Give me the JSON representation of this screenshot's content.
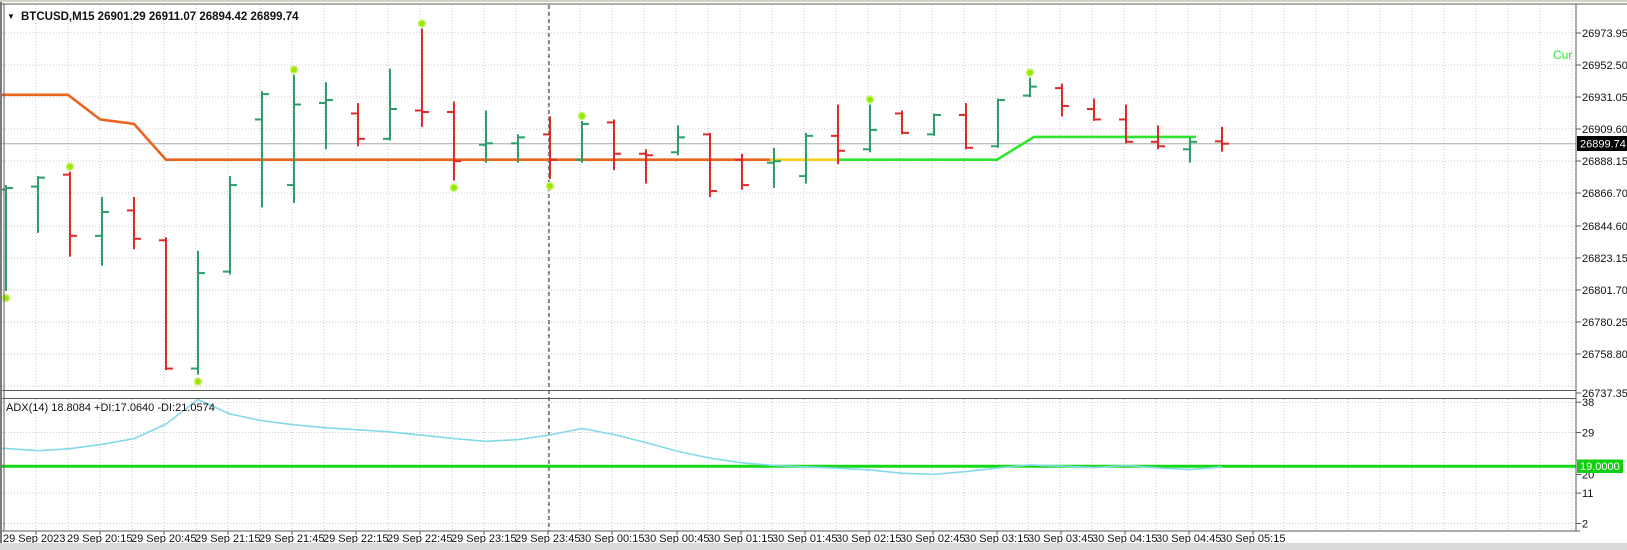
{
  "header": {
    "dropdown_icon": "▼",
    "title_text": "BTCUSD,M15  26901.29 26911.07 26894.42 26899.74",
    "symbol": "BTCUSD",
    "period": "M15"
  },
  "main_panel": {
    "price_axis_labels": [
      26973.95,
      26952.5,
      26931.05,
      26909.6,
      26888.15,
      26866.7,
      26844.6,
      26823.15,
      26801.7,
      26780.25,
      26758.8,
      26737.35
    ],
    "current_price_tag": "26899.74",
    "overlay_label": "Cur"
  },
  "adx_panel": {
    "indicator_label": "ADX(14) 18.8084 +DI:17.0640 -DI:21.0574",
    "axis_labels": [
      38,
      29,
      20,
      11,
      2
    ],
    "level_tag": "19.0000"
  },
  "time_axis": {
    "labels": [
      "29 Sep 2023",
      "29 Sep 20:15",
      "29 Sep 20:45",
      "29 Sep 21:15",
      "29 Sep 21:45",
      "29 Sep 22:15",
      "29 Sep 22:45",
      "29 Sep 23:15",
      "29 Sep 23:45",
      "30 Sep 00:15",
      "30 Sep 00:45",
      "30 Sep 01:15",
      "30 Sep 01:45",
      "30 Sep 02:15",
      "30 Sep 02:45",
      "30 Sep 03:15",
      "30 Sep 03:45",
      "30 Sep 04:15",
      "30 Sep 04:45",
      "30 Sep 05:15"
    ]
  },
  "colors": {
    "bull": "#2E9D68",
    "bear": "#E02A2A",
    "trend_orange": "#E8651D",
    "trend_yellow": "#F2D21F",
    "trend_green": "#2FE42F",
    "adx_line": "#84D9E8",
    "level_green": "#16D916",
    "signal_dot": "#97E603",
    "signal_dot_rim": "#C9F26E",
    "grid": "#C9C9C9",
    "current_price_line": "#A8A8A8",
    "price_tag_bg": "#000000",
    "level_tag_bg": "#10CF10",
    "border": "#5A5A5A",
    "separator_line": "#222222"
  },
  "chart_data": [
    {
      "type": "ohlc",
      "title": "BTCUSD M15 price panel",
      "price_axis_range": [
        26737.35,
        26973.95
      ],
      "current_price": 26899.74,
      "current_bar_ohlc": {
        "open": 26901.29,
        "high": 26911.07,
        "low": 26894.42,
        "close": 26899.74
      },
      "bar_fields": [
        "open",
        "high",
        "low",
        "close",
        "direction",
        "signal_dot"
      ],
      "bars": [
        [
          26869,
          26872,
          26801,
          26870,
          "up",
          "below"
        ],
        [
          26871,
          26878,
          26840,
          26877,
          "up",
          null
        ],
        [
          26879,
          26881,
          26824,
          26838,
          "down",
          "above"
        ],
        [
          26838,
          26864,
          26818,
          26854,
          "up",
          null
        ],
        [
          26855,
          26864,
          26829,
          26836,
          "down",
          null
        ],
        [
          26835,
          26837,
          26748,
          26749,
          "down",
          null
        ],
        [
          26749,
          26828,
          26745,
          26813,
          "up",
          "below"
        ],
        [
          26814,
          26878,
          26812,
          26872,
          "up",
          null
        ],
        [
          26916,
          26935,
          26857,
          26933,
          "up",
          null
        ],
        [
          26872,
          26946,
          26860,
          26926,
          "up",
          "above"
        ],
        [
          26927,
          26941,
          26896,
          26929,
          "up",
          null
        ],
        [
          26920,
          26927,
          26898,
          26903,
          "down",
          null
        ],
        [
          26903,
          26950,
          26902,
          26923,
          "up",
          null
        ],
        [
          26922,
          26977,
          26911,
          26921,
          "down",
          "above"
        ],
        [
          26921,
          26928,
          26875,
          26888,
          "down",
          "below"
        ],
        [
          26899,
          26922,
          26887,
          26900,
          "up",
          null
        ],
        [
          26900,
          26906,
          26887,
          26904,
          "up",
          null
        ],
        [
          26906,
          26918,
          26876,
          26889,
          "down",
          "below"
        ],
        [
          26889,
          26915,
          26887,
          26913,
          "up",
          "above"
        ],
        [
          26914,
          26916,
          26882,
          26893,
          "down",
          null
        ],
        [
          26893,
          26896,
          26873,
          26892,
          "down",
          null
        ],
        [
          26894,
          26912,
          26892,
          26904,
          "up",
          null
        ],
        [
          26906,
          26907,
          26864,
          26868,
          "down",
          null
        ],
        [
          26889,
          26893,
          26869,
          26872,
          "down",
          null
        ],
        [
          26887,
          26897,
          26870,
          26888,
          "up",
          null
        ],
        [
          26878,
          26907,
          26873,
          26905,
          "up",
          null
        ],
        [
          26905,
          26926,
          26886,
          26895,
          "down",
          null
        ],
        [
          26896,
          26926,
          26894,
          26909,
          "up",
          "above"
        ],
        [
          26920,
          26922,
          26906,
          26907,
          "down",
          null
        ],
        [
          26906,
          26920,
          26905,
          26919,
          "up",
          null
        ],
        [
          26919,
          26927,
          26896,
          26897,
          "down",
          null
        ],
        [
          26898,
          26930,
          26897,
          26929,
          "up",
          null
        ],
        [
          26932,
          26944,
          26931,
          26938,
          "up",
          "above"
        ],
        [
          26937,
          26940,
          26918,
          26925,
          "down",
          null
        ],
        [
          26923,
          26930,
          26915,
          26916,
          "down",
          null
        ],
        [
          26916,
          26926,
          26900,
          26901,
          "down",
          null
        ],
        [
          26901,
          26912,
          26896,
          26898,
          "down",
          null
        ],
        [
          26896,
          26904,
          26887,
          26901,
          "up",
          null
        ],
        [
          26901.29,
          26911.07,
          26894.42,
          26899.74,
          "down",
          null
        ]
      ],
      "trend_line_segments": [
        {
          "color_key": "trend_orange",
          "points": [
            [
              2,
              26932.5
            ],
            [
              68,
              26932.5
            ],
            [
              100,
              26916
            ],
            [
              134,
              26913
            ],
            [
              166,
              26889
            ],
            [
              770,
              26889
            ]
          ]
        },
        {
          "color_key": "trend_yellow",
          "points": [
            [
              770,
              26889
            ],
            [
              838,
              26889
            ]
          ]
        },
        {
          "color_key": "trend_green",
          "points": [
            [
              838,
              26889
            ],
            [
              997,
              26889
            ],
            [
              1034,
              26904.3
            ],
            [
              1196,
              26904.3
            ]
          ]
        }
      ],
      "vertical_separator_bar_index": 17
    },
    {
      "type": "line",
      "name": "ADX(14)",
      "current": 18.8084,
      "plus_di": 17.064,
      "minus_di": 21.0574,
      "level_line": 19.0,
      "y_axis_labels": [
        38,
        29,
        20,
        11,
        2
      ],
      "values": [
        24.3,
        23.6,
        24.2,
        25.5,
        27.2,
        31.5,
        38.8,
        34.5,
        32.5,
        31.3,
        30.4,
        29.8,
        29.2,
        28.2,
        27.2,
        26.4,
        26.9,
        28.3,
        30.2,
        28.4,
        26.0,
        23.4,
        21.4,
        20.0,
        19.2,
        18.8,
        18.4,
        17.9,
        16.9,
        16.6,
        17.4,
        18.5,
        19.4,
        19.0,
        18.6,
        19.2,
        18.5,
        18.0,
        18.8084
      ]
    }
  ]
}
